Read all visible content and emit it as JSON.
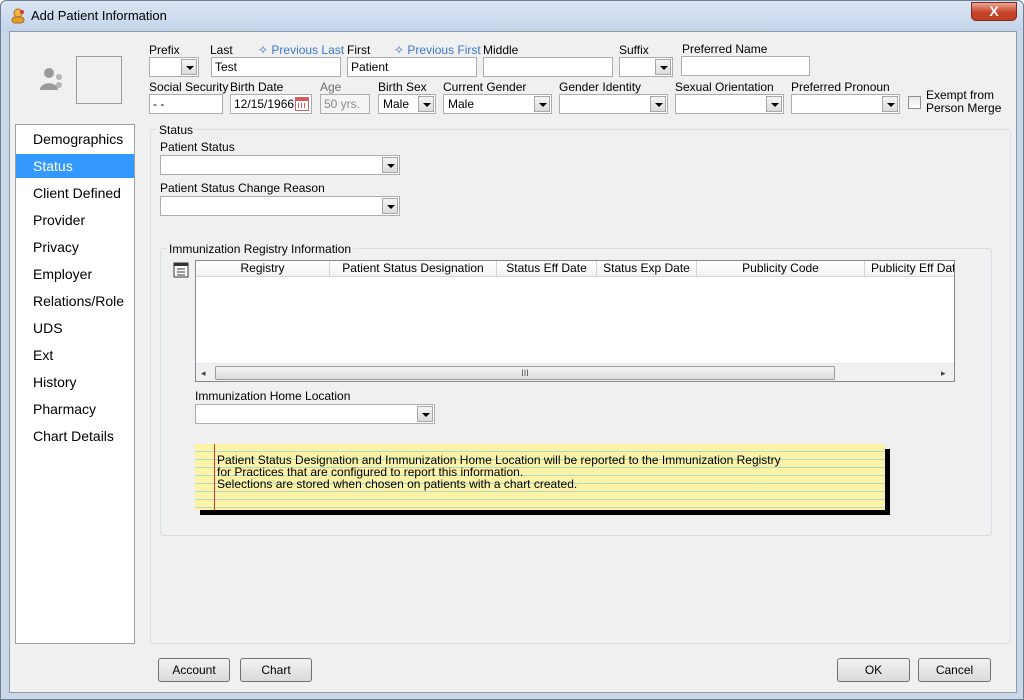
{
  "window": {
    "title": "Add Patient Information",
    "close_glyph": "X"
  },
  "header": {
    "prefix_label": "Prefix",
    "last_label": "Last",
    "last_value": "Test",
    "previous_last_link": "Previous Last",
    "first_label": "First",
    "first_value": "Patient",
    "previous_first_link": "Previous First",
    "middle_label": "Middle",
    "suffix_label": "Suffix",
    "preferred_name_label": "Preferred Name",
    "ssn_label": "Social Security",
    "ssn_value": " -  -",
    "birth_date_label": "Birth Date",
    "birth_date_value": "12/15/1966",
    "age_label": "Age",
    "age_value": "50 yrs.",
    "birth_sex_label": "Birth Sex",
    "birth_sex_value": "Male",
    "current_gender_label": "Current Gender",
    "current_gender_value": "Male",
    "gender_identity_label": "Gender Identity",
    "sexual_orientation_label": "Sexual Orientation",
    "preferred_pronoun_label": "Preferred Pronoun",
    "exempt_label_1": "Exempt from",
    "exempt_label_2": "Person Merge"
  },
  "sidebar": {
    "items": [
      {
        "label": "Demographics"
      },
      {
        "label": "Status"
      },
      {
        "label": "Client Defined"
      },
      {
        "label": "Provider"
      },
      {
        "label": "Privacy"
      },
      {
        "label": "Employer"
      },
      {
        "label": "Relations/Role"
      },
      {
        "label": "UDS"
      },
      {
        "label": "Ext"
      },
      {
        "label": "History"
      },
      {
        "label": "Pharmacy"
      },
      {
        "label": "Chart Details"
      }
    ],
    "active_index": 1
  },
  "status": {
    "group_title": "Status",
    "patient_status_label": "Patient Status",
    "patient_status_value": "",
    "change_reason_label": "Patient Status Change Reason",
    "change_reason_value": ""
  },
  "immunization": {
    "group_title": "Immunization Registry Information",
    "columns": [
      "Registry",
      "Patient Status Designation",
      "Status Eff Date",
      "Status Exp Date",
      "Publicity Code",
      "Publicity Eff Date"
    ],
    "rows": [],
    "home_location_label": "Immunization Home Location",
    "home_location_value": "",
    "scroll_grip": "III"
  },
  "note": {
    "lines": [
      "Patient Status Designation and Immunization Home Location will be reported to the Immunization Registry",
      "for Practices that are configured to report this information.",
      "Selections are stored when chosen on patients with a chart created."
    ]
  },
  "footer": {
    "account_label": "Account",
    "chart_label": "Chart",
    "ok_label": "OK",
    "cancel_label": "Cancel"
  }
}
